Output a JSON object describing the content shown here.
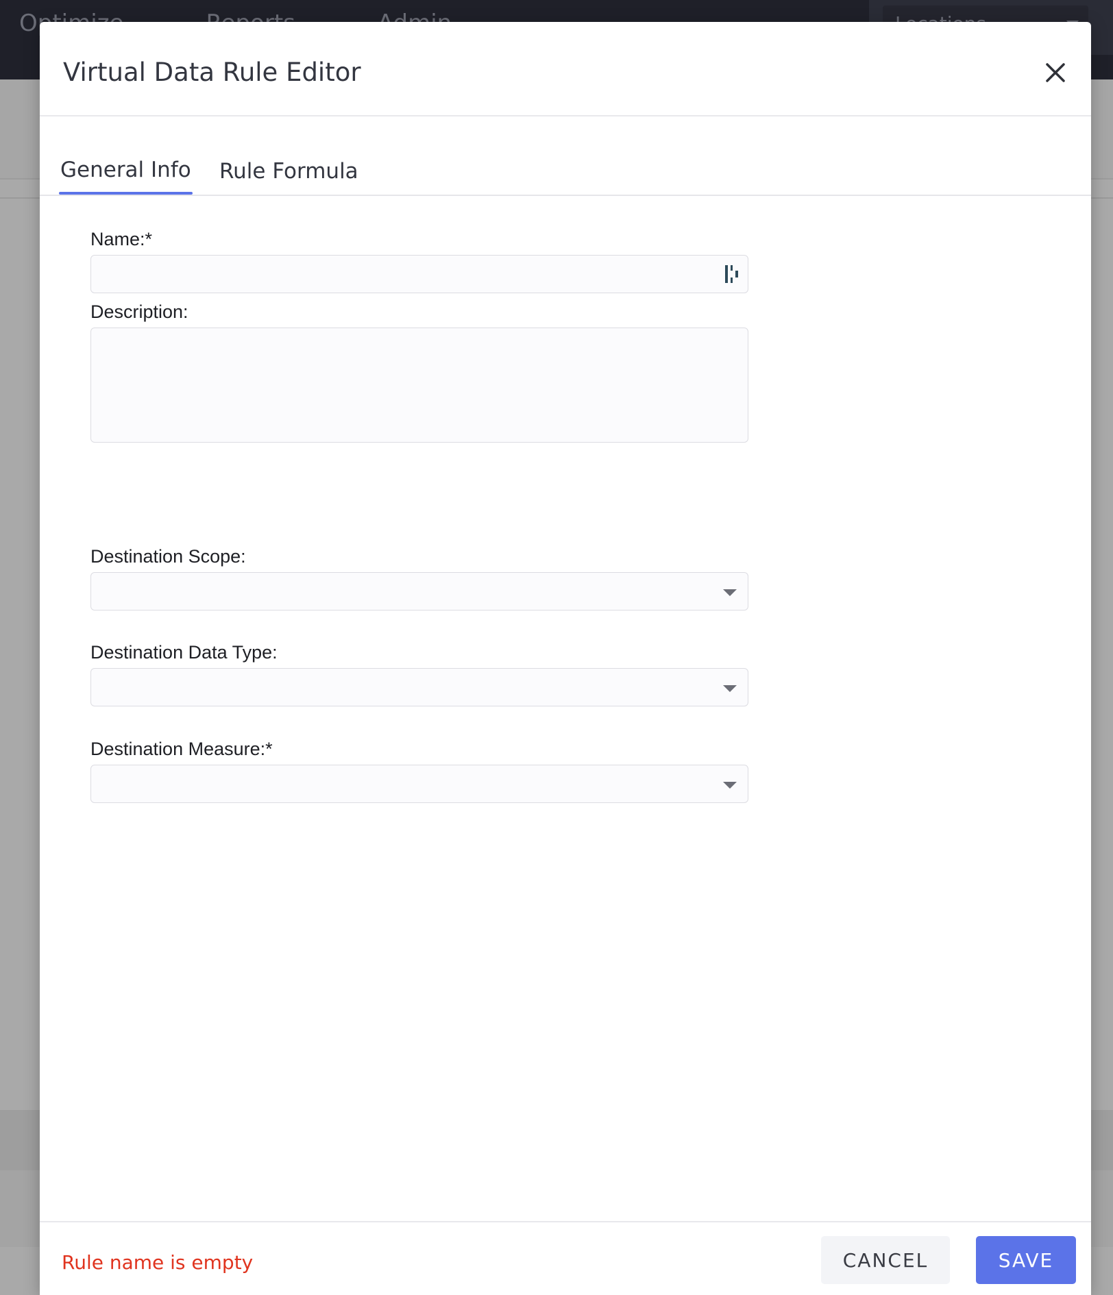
{
  "background": {
    "nav": [
      "Optimize",
      "Reports",
      "Admin"
    ],
    "locations_label": "Locations"
  },
  "modal": {
    "title": "Virtual Data Rule Editor",
    "tabs": [
      {
        "label": "General Info",
        "active": true
      },
      {
        "label": "Rule Formula",
        "active": false
      }
    ],
    "fields": {
      "name": {
        "label": "Name:*",
        "value": "",
        "placeholder": ""
      },
      "description": {
        "label": "Description:",
        "value": "",
        "placeholder": ""
      },
      "destination_scope": {
        "label": "Destination Scope:",
        "value": ""
      },
      "destination_data_type": {
        "label": "Destination Data Type:",
        "value": ""
      },
      "destination_measure": {
        "label": "Destination Measure:*",
        "value": ""
      }
    },
    "error_message": "Rule name is empty",
    "cancel_label": "CANCEL",
    "save_label": "SAVE"
  },
  "colors": {
    "accent": "#5b73e8",
    "error": "#e0341f",
    "header_bg": "#1f2029"
  },
  "icons": {
    "close": "close-icon",
    "name_field_icon": "text-cursor-icon",
    "dropdown": "chevron-down-icon"
  }
}
